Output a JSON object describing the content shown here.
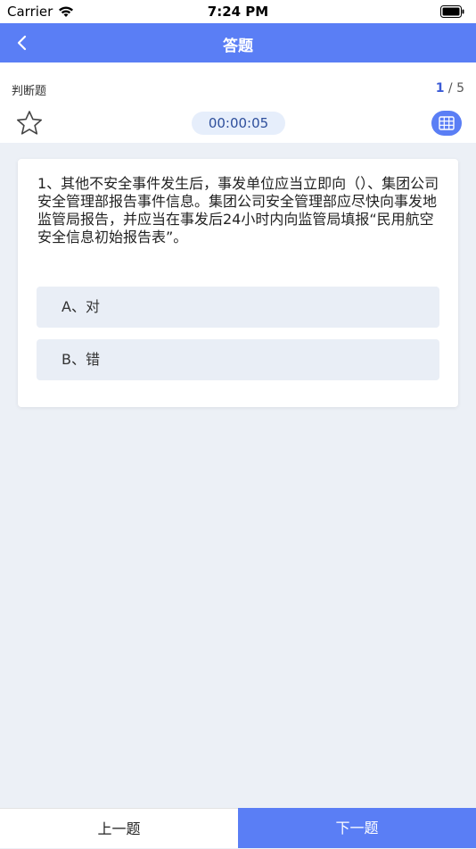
{
  "status_bar": {
    "carrier": "Carrier",
    "time": "7:24 PM",
    "wifi_icon": "wifi-icon",
    "battery_icon": "battery-icon"
  },
  "nav": {
    "title": "答题",
    "back_icon": "chevron-left-icon"
  },
  "info": {
    "question_type": "判断题",
    "current": "1",
    "separator": " / ",
    "total": "5",
    "timer": "00:00:05",
    "favorite_icon": "star-outline-icon",
    "answer_sheet_icon": "grid-icon"
  },
  "question": {
    "text": "1、其他不安全事件发生后，事发单位应当立即向（）、集团公司安全管理部报告事件信息。集团公司安全管理部应尽快向事发地监管局报告，并应当在事发后24小时内向监管局填报“民用航空安全信息初始报告表”。",
    "options": [
      {
        "label": "A、对"
      },
      {
        "label": "B、错"
      }
    ]
  },
  "bottom": {
    "prev_label": "上一题",
    "next_label": "下一题"
  },
  "colors": {
    "primary": "#5a7ef5",
    "background": "#ecf0f6",
    "option_bg": "#e9eef6",
    "timer_bg": "#e6eefb"
  }
}
